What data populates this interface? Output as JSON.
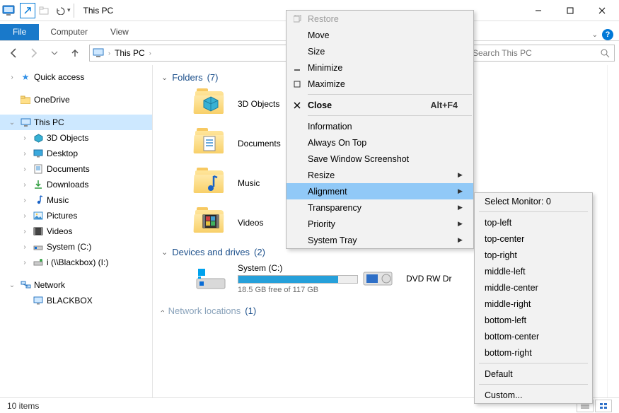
{
  "titlebar": {
    "caption": "This PC"
  },
  "ribbon": {
    "file": "File",
    "tabs": [
      "Computer",
      "View"
    ]
  },
  "nav": {
    "breadcrumb": "This PC"
  },
  "search": {
    "placeholder": "Search This PC"
  },
  "tree": {
    "quick_access": "Quick access",
    "onedrive": "OneDrive",
    "this_pc": "This PC",
    "items": [
      "3D Objects",
      "Desktop",
      "Documents",
      "Downloads",
      "Music",
      "Pictures",
      "Videos",
      "System (C:)",
      "i (\\\\Blackbox) (I:)"
    ],
    "network": "Network",
    "network_items": [
      "BLACKBOX"
    ]
  },
  "groups": {
    "folders": {
      "title": "Folders",
      "count": "(7)"
    },
    "drives": {
      "title": "Devices and drives",
      "count": "(2)"
    },
    "netloc": {
      "title": "Network locations",
      "count": "(1)"
    }
  },
  "folders": [
    "3D Objects",
    "Documents",
    "Music",
    "Videos"
  ],
  "drive": {
    "name": "System (C:)",
    "free_text": "18.5 GB free of 117 GB",
    "fill_percent": 84
  },
  "dvd": {
    "name": "DVD RW Dr"
  },
  "status": {
    "items": "10 items"
  },
  "sysmenu": {
    "restore": "Restore",
    "move": "Move",
    "size": "Size",
    "minimize": "Minimize",
    "maximize": "Maximize",
    "close": "Close",
    "close_acc": "Alt+F4",
    "info": "Information",
    "aot": "Always On Top",
    "save_ss": "Save Window Screenshot",
    "resize": "Resize",
    "alignment": "Alignment",
    "transparency": "Transparency",
    "priority": "Priority",
    "systray": "System Tray"
  },
  "alignmenu": {
    "select_monitor": "Select Monitor: 0",
    "pos": [
      "top-left",
      "top-center",
      "top-right",
      "middle-left",
      "middle-center",
      "middle-right",
      "bottom-left",
      "bottom-center",
      "bottom-right"
    ],
    "default": "Default",
    "custom": "Custom..."
  }
}
